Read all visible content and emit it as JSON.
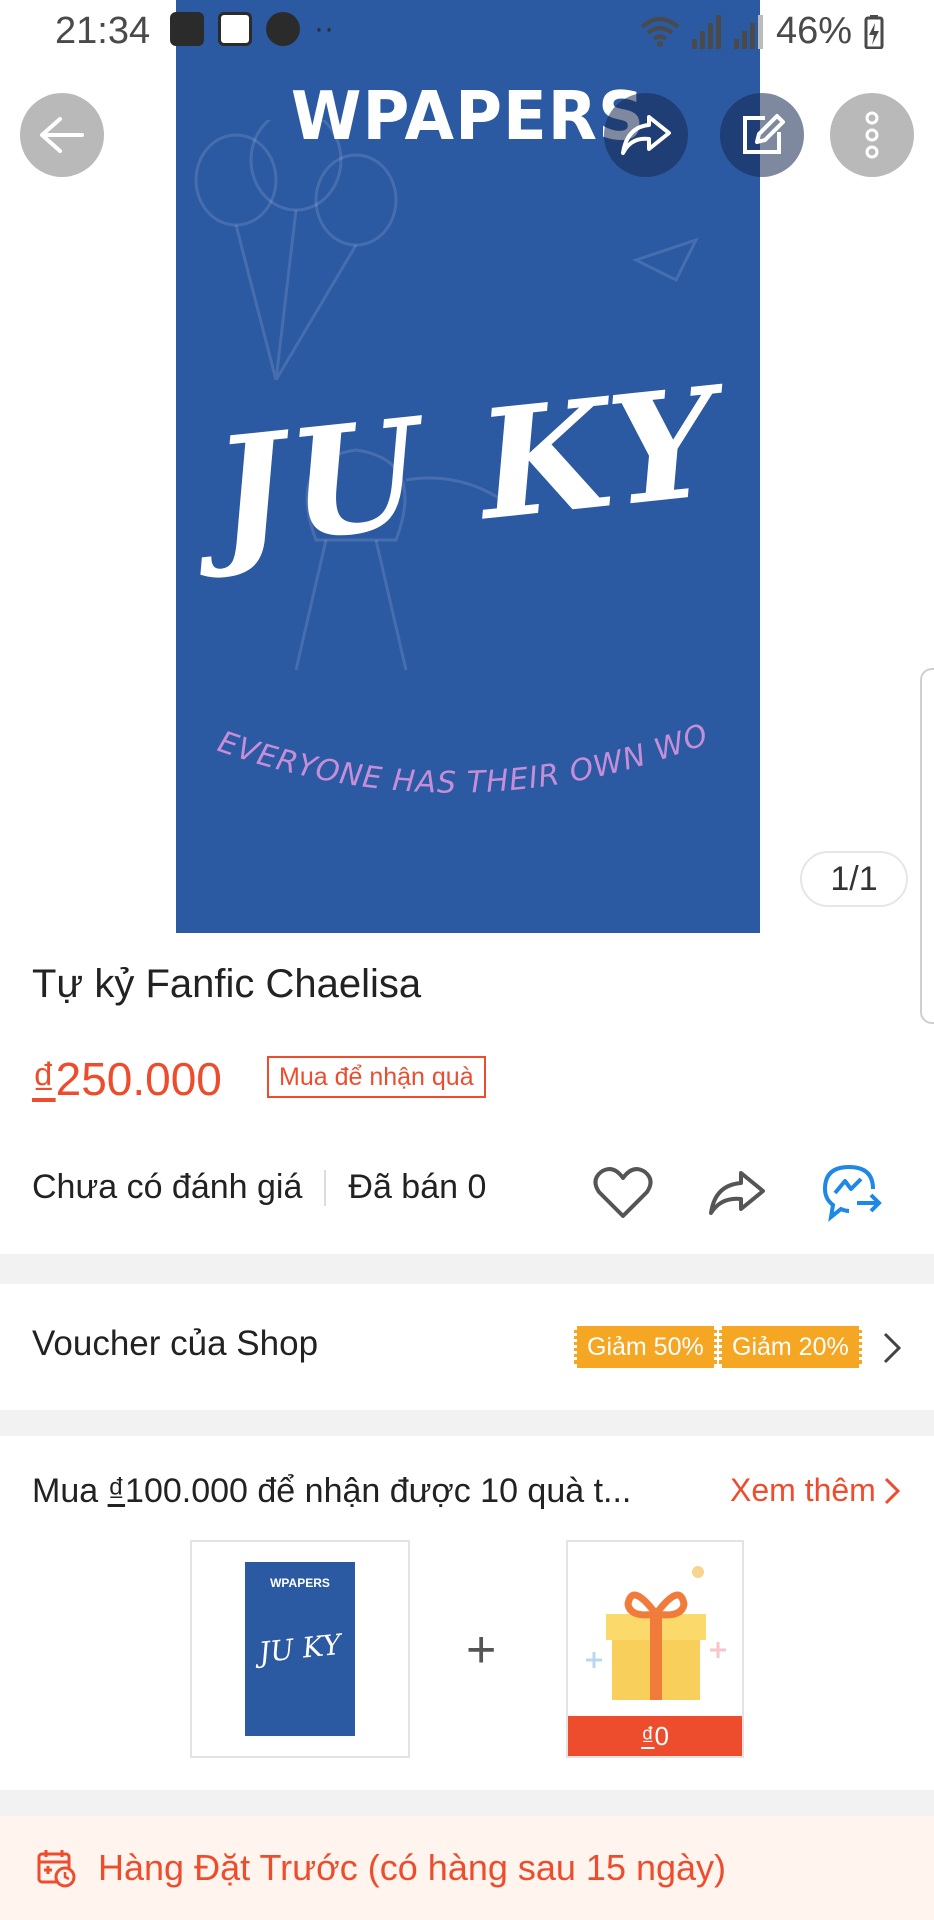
{
  "status_bar": {
    "time": "21:34",
    "battery": "46%",
    "icons": [
      "gallery-icon",
      "cloud-app-icon",
      "s-app-icon",
      "more-dots-icon",
      "wifi-icon",
      "signal-icon",
      "signal-icon",
      "battery-charging-icon"
    ]
  },
  "cover": {
    "brand": "WPAPERS",
    "title": "JU KY",
    "tagline": "EVERYONE HAS THEIR OWN WORLD",
    "background": "#2b59a2",
    "tagline_color": "#c58ed8"
  },
  "toolbar": {
    "back_icon": "back-arrow-icon",
    "share_icon": "share-icon",
    "edit_icon": "edit-icon",
    "more_icon": "more-vertical-icon"
  },
  "image_counter": "1/1",
  "product": {
    "title": "Tự kỷ Fanfic Chaelisa",
    "price_currency": "₫",
    "price_value": "250.000",
    "gift_tag": "Mua để nhận quà",
    "rating_text": "Chưa có đánh giá",
    "sold_text": "Đã bán 0"
  },
  "actions": [
    "heart-icon",
    "share-icon",
    "messenger-icon"
  ],
  "voucher": {
    "label": "Voucher của Shop",
    "chips": [
      "Giảm 50%",
      "Giảm 20%"
    ]
  },
  "bundle": {
    "title_prefix": "Mua ",
    "title_currency": "₫",
    "title_rest": "100.000 để nhận được 10 quà t...",
    "see_more": "Xem thêm",
    "plus": "+",
    "thumb_brand": "WPAPERS",
    "thumb_title": "JU KY",
    "gift_currency": "₫",
    "gift_value": "0"
  },
  "preorder": {
    "text": "Hàng Đặt Trước (có hàng sau 15 ngày)"
  },
  "colors": {
    "accent": "#ee4d2d",
    "voucher": "#f5a623",
    "messenger": "#1e88e5"
  }
}
